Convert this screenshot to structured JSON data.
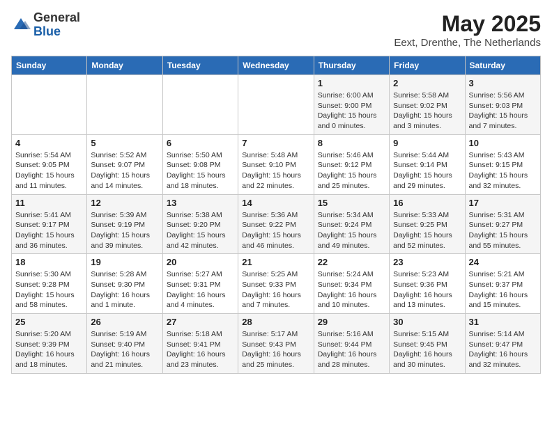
{
  "header": {
    "logo_line1": "General",
    "logo_line2": "Blue",
    "month_year": "May 2025",
    "location": "Eext, Drenthe, The Netherlands"
  },
  "weekdays": [
    "Sunday",
    "Monday",
    "Tuesday",
    "Wednesday",
    "Thursday",
    "Friday",
    "Saturday"
  ],
  "weeks": [
    [
      {
        "day": "",
        "info": ""
      },
      {
        "day": "",
        "info": ""
      },
      {
        "day": "",
        "info": ""
      },
      {
        "day": "",
        "info": ""
      },
      {
        "day": "1",
        "info": "Sunrise: 6:00 AM\nSunset: 9:00 PM\nDaylight: 15 hours\nand 0 minutes."
      },
      {
        "day": "2",
        "info": "Sunrise: 5:58 AM\nSunset: 9:02 PM\nDaylight: 15 hours\nand 3 minutes."
      },
      {
        "day": "3",
        "info": "Sunrise: 5:56 AM\nSunset: 9:03 PM\nDaylight: 15 hours\nand 7 minutes."
      }
    ],
    [
      {
        "day": "4",
        "info": "Sunrise: 5:54 AM\nSunset: 9:05 PM\nDaylight: 15 hours\nand 11 minutes."
      },
      {
        "day": "5",
        "info": "Sunrise: 5:52 AM\nSunset: 9:07 PM\nDaylight: 15 hours\nand 14 minutes."
      },
      {
        "day": "6",
        "info": "Sunrise: 5:50 AM\nSunset: 9:08 PM\nDaylight: 15 hours\nand 18 minutes."
      },
      {
        "day": "7",
        "info": "Sunrise: 5:48 AM\nSunset: 9:10 PM\nDaylight: 15 hours\nand 22 minutes."
      },
      {
        "day": "8",
        "info": "Sunrise: 5:46 AM\nSunset: 9:12 PM\nDaylight: 15 hours\nand 25 minutes."
      },
      {
        "day": "9",
        "info": "Sunrise: 5:44 AM\nSunset: 9:14 PM\nDaylight: 15 hours\nand 29 minutes."
      },
      {
        "day": "10",
        "info": "Sunrise: 5:43 AM\nSunset: 9:15 PM\nDaylight: 15 hours\nand 32 minutes."
      }
    ],
    [
      {
        "day": "11",
        "info": "Sunrise: 5:41 AM\nSunset: 9:17 PM\nDaylight: 15 hours\nand 36 minutes."
      },
      {
        "day": "12",
        "info": "Sunrise: 5:39 AM\nSunset: 9:19 PM\nDaylight: 15 hours\nand 39 minutes."
      },
      {
        "day": "13",
        "info": "Sunrise: 5:38 AM\nSunset: 9:20 PM\nDaylight: 15 hours\nand 42 minutes."
      },
      {
        "day": "14",
        "info": "Sunrise: 5:36 AM\nSunset: 9:22 PM\nDaylight: 15 hours\nand 46 minutes."
      },
      {
        "day": "15",
        "info": "Sunrise: 5:34 AM\nSunset: 9:24 PM\nDaylight: 15 hours\nand 49 minutes."
      },
      {
        "day": "16",
        "info": "Sunrise: 5:33 AM\nSunset: 9:25 PM\nDaylight: 15 hours\nand 52 minutes."
      },
      {
        "day": "17",
        "info": "Sunrise: 5:31 AM\nSunset: 9:27 PM\nDaylight: 15 hours\nand 55 minutes."
      }
    ],
    [
      {
        "day": "18",
        "info": "Sunrise: 5:30 AM\nSunset: 9:28 PM\nDaylight: 15 hours\nand 58 minutes."
      },
      {
        "day": "19",
        "info": "Sunrise: 5:28 AM\nSunset: 9:30 PM\nDaylight: 16 hours\nand 1 minute."
      },
      {
        "day": "20",
        "info": "Sunrise: 5:27 AM\nSunset: 9:31 PM\nDaylight: 16 hours\nand 4 minutes."
      },
      {
        "day": "21",
        "info": "Sunrise: 5:25 AM\nSunset: 9:33 PM\nDaylight: 16 hours\nand 7 minutes."
      },
      {
        "day": "22",
        "info": "Sunrise: 5:24 AM\nSunset: 9:34 PM\nDaylight: 16 hours\nand 10 minutes."
      },
      {
        "day": "23",
        "info": "Sunrise: 5:23 AM\nSunset: 9:36 PM\nDaylight: 16 hours\nand 13 minutes."
      },
      {
        "day": "24",
        "info": "Sunrise: 5:21 AM\nSunset: 9:37 PM\nDaylight: 16 hours\nand 15 minutes."
      }
    ],
    [
      {
        "day": "25",
        "info": "Sunrise: 5:20 AM\nSunset: 9:39 PM\nDaylight: 16 hours\nand 18 minutes."
      },
      {
        "day": "26",
        "info": "Sunrise: 5:19 AM\nSunset: 9:40 PM\nDaylight: 16 hours\nand 21 minutes."
      },
      {
        "day": "27",
        "info": "Sunrise: 5:18 AM\nSunset: 9:41 PM\nDaylight: 16 hours\nand 23 minutes."
      },
      {
        "day": "28",
        "info": "Sunrise: 5:17 AM\nSunset: 9:43 PM\nDaylight: 16 hours\nand 25 minutes."
      },
      {
        "day": "29",
        "info": "Sunrise: 5:16 AM\nSunset: 9:44 PM\nDaylight: 16 hours\nand 28 minutes."
      },
      {
        "day": "30",
        "info": "Sunrise: 5:15 AM\nSunset: 9:45 PM\nDaylight: 16 hours\nand 30 minutes."
      },
      {
        "day": "31",
        "info": "Sunrise: 5:14 AM\nSunset: 9:47 PM\nDaylight: 16 hours\nand 32 minutes."
      }
    ]
  ]
}
